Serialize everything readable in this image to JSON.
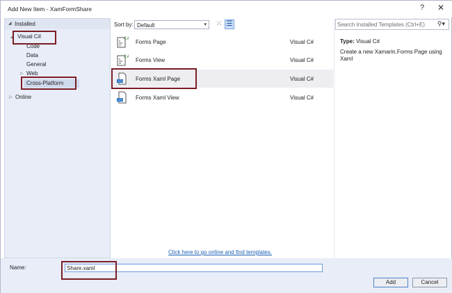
{
  "window": {
    "title": "Add New Item - XamFormShare",
    "help": "?",
    "close": "✕"
  },
  "tree": {
    "installed": "Installed",
    "visual_csharp": "Visual C#",
    "code": "Code",
    "data": "Data",
    "general": "General",
    "web": "Web",
    "cross_platform": "Cross-Platform",
    "online": "Online"
  },
  "sort": {
    "label": "Sort by:",
    "value": "Default"
  },
  "templates": [
    {
      "name": "Forms Page",
      "lang": "Visual C#"
    },
    {
      "name": "Forms View",
      "lang": "Visual C#"
    },
    {
      "name": "Forms Xaml Page",
      "lang": "Visual C#"
    },
    {
      "name": "Forms Xaml View",
      "lang": "Visual C#"
    }
  ],
  "online_link": "Click here to go online and find templates.",
  "details": {
    "search_placeholder": "Search Installed Templates (Ctrl+E)",
    "type_label": "Type:",
    "type_value": "Visual C#",
    "description": "Create a new Xamarin.Forms Page using Xaml"
  },
  "footer": {
    "name_label": "Name:",
    "name_value": "Share.xaml",
    "add": "Add",
    "cancel": "Cancel"
  },
  "colors": {
    "highlight": "#7b1c24",
    "link": "#1a5fb4",
    "panel": "#e8edf7"
  },
  "icons": {
    "search": "search-icon",
    "list_view": "list-view-icon",
    "grid_view": "grid-view-icon",
    "page_template": "page-template-icon",
    "xaml_template": "xaml-template-icon"
  }
}
